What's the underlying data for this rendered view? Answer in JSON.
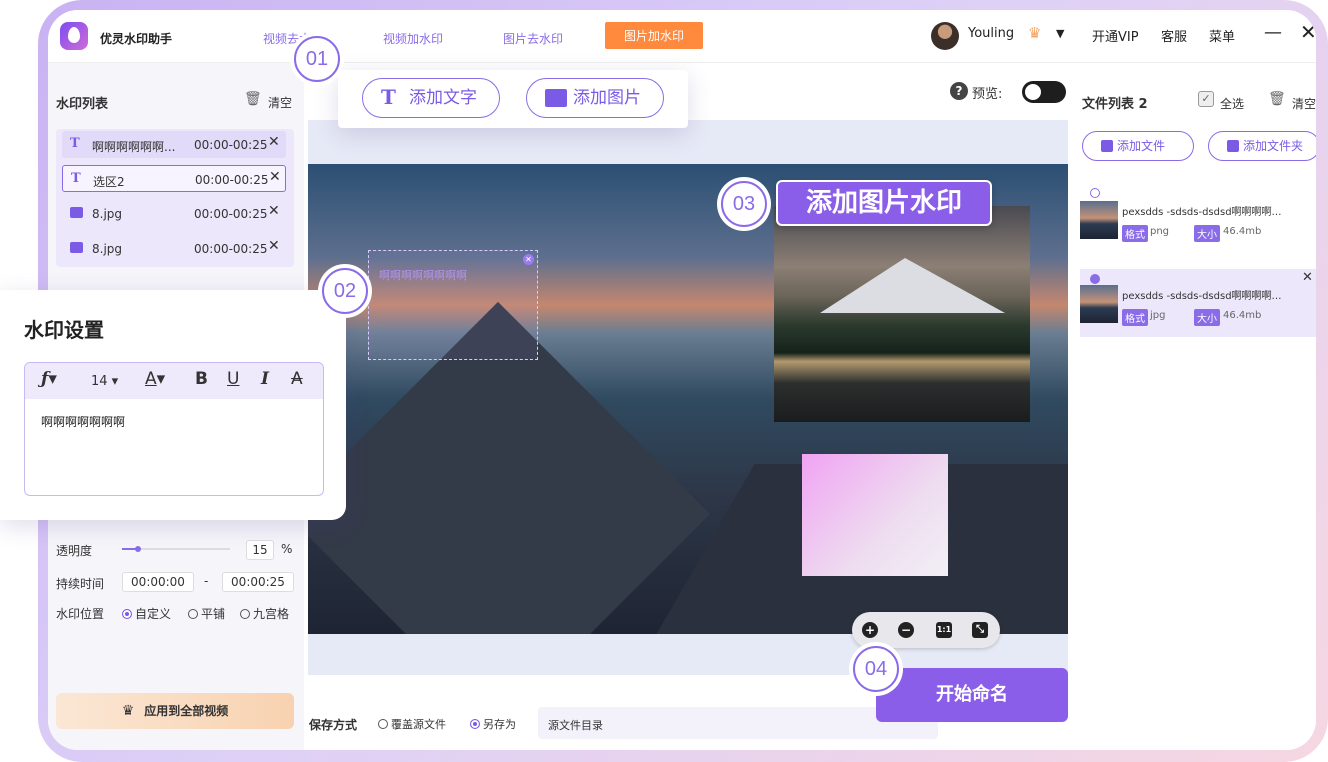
{
  "app": {
    "title": "优灵水印助手"
  },
  "nav": {
    "tabs": [
      {
        "label": "视频去水印"
      },
      {
        "label": "视频加水印"
      },
      {
        "label": "图片去水印"
      },
      {
        "label": "图片加水印",
        "active": true
      }
    ]
  },
  "user": {
    "name": "Youling"
  },
  "header": {
    "vip": "开通VIP",
    "service": "客服",
    "menu": "菜单"
  },
  "left": {
    "list_title": "水印列表",
    "clear": "清空",
    "items": [
      {
        "icon": "text",
        "name": "啊啊啊啊啊啊...",
        "time": "00:00-00:25"
      },
      {
        "icon": "text",
        "name": "选区2",
        "time": "00:00-00:25"
      },
      {
        "icon": "image",
        "name": "8.jpg",
        "time": "00:00-00:25"
      },
      {
        "icon": "image",
        "name": "8.jpg",
        "time": "00:00-00:25"
      }
    ],
    "opacity_label": "透明度",
    "opacity_value": "15",
    "opacity_unit": "%",
    "opacity_level": 0.15,
    "duration_label": "持续时间",
    "duration_start": "00:00:00",
    "duration_dash": "-",
    "duration_end": "00:00:25",
    "position_label": "水印位置",
    "position_options": [
      "自定义",
      "平铺",
      "九宫格"
    ],
    "apply_all": "应用到全部视频"
  },
  "settings_popup": {
    "title": "水印设置",
    "font_size": "14",
    "font_color_glyph": "A",
    "bold": "B",
    "underline": "U",
    "italic": "I",
    "strike": "A",
    "text": "啊啊啊啊啊啊啊"
  },
  "toolbar_popup": {
    "add_text": "添加文字",
    "add_image": "添加图片",
    "text_icon_glyph": "T"
  },
  "callouts": {
    "c1": "01",
    "c2": "02",
    "c3": "03",
    "c4": "04"
  },
  "callout3_label": "添加图片水印",
  "canvas": {
    "watermark_text": "啊啊啊啊啊啊啊啊"
  },
  "preview": {
    "label": "预览:",
    "help_glyph": "?"
  },
  "save": {
    "label": "保存方式",
    "overwrite": "覆盖源文件",
    "save_as": "另存为",
    "path": "源文件目录"
  },
  "start_button": "开始命名",
  "files": {
    "title": "文件列表 2",
    "select_all": "全选",
    "clear": "清空",
    "add_file": "添加文件",
    "add_folder": "添加文件夹",
    "items": [
      {
        "name": "pexsdds -sdsds-dsdsd啊啊啊啊…",
        "format_label": "格式",
        "format": "png",
        "size_label": "大小",
        "size": "46.4mb"
      },
      {
        "name": "pexsdds -sdsds-dsdsd啊啊啊啊…",
        "format_label": "格式",
        "format": "jpg",
        "size_label": "大小",
        "size": "46.4mb"
      }
    ]
  },
  "colors": {
    "accent": "#8a5ee8",
    "active_tab": "#ff8a3d"
  }
}
